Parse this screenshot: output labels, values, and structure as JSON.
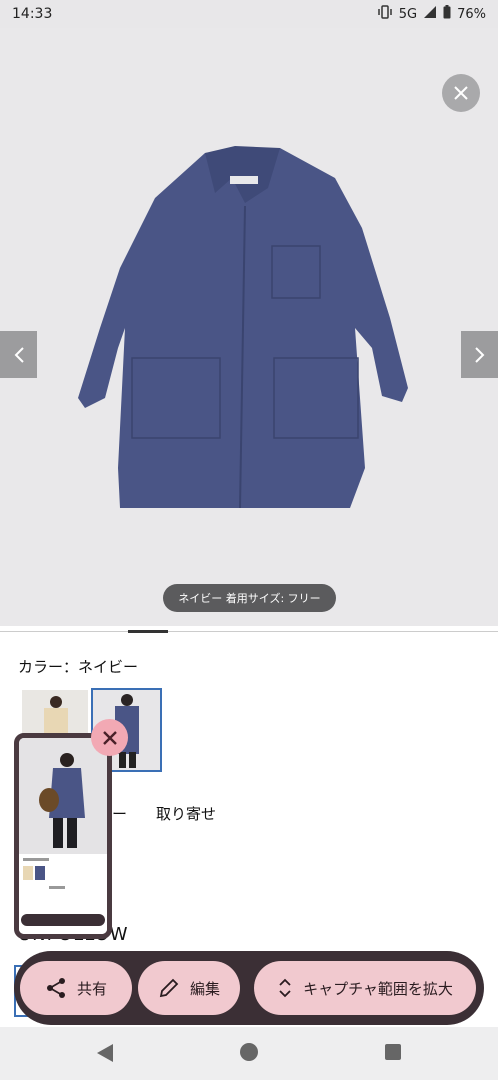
{
  "status": {
    "time": "14:33",
    "network": "5G",
    "battery": "76%"
  },
  "photo": {
    "caption": "ネイビー 着用サイズ: フリー"
  },
  "product": {
    "color_label": "カラー：ネイビー",
    "size_dash": "ー",
    "order_label": "取り寄せ",
    "follow_text": "UNFOLLOW"
  },
  "actions": {
    "share": "共有",
    "edit": "編集",
    "expand": "キャプチャ範囲を拡大"
  },
  "colors": {
    "accent_border": "#3a6fb5",
    "action_bar": "#3b2f35",
    "action_button": "#f1c9cf",
    "coat": "#4a5586"
  }
}
